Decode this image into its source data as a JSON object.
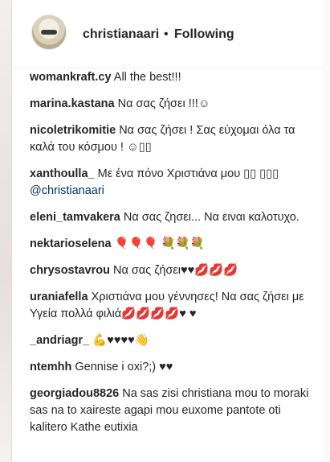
{
  "header": {
    "username": "christianaari",
    "separator": "•",
    "follow_status": "Following"
  },
  "comments": [
    {
      "user": "womankraft.cy",
      "text": "All the best!!!"
    },
    {
      "user": "marina.kastana",
      "text": "Να σας ζήσει !!!☺"
    },
    {
      "user": "nicoletrikomitie",
      "text": "Να σας ζήσει ! Σας εύχομαι όλα τα καλά του κόσμου ! ☺▯▯"
    },
    {
      "user": "xanthoulla_",
      "text": "Με ένα πόνο Χριστιάνα μου ▯▯ ▯▯▯",
      "mention": "@christianaari"
    },
    {
      "user": "eleni_tamvakera",
      "text": "Να σας ζησει... Να ειναι καλοτυχο."
    },
    {
      "user": "nektarioselena",
      "text": "🎈🎈🎈 💐💐💐"
    },
    {
      "user": "chrysostavrou",
      "text": "Να σας ζήσει♥♥💋💋💋"
    },
    {
      "user": "uraniafella",
      "text": "Χριστιάνα μου γέννησες! Να σας ζήσει με Υγεία πολλά φιλιά💋💋💋💋♥ ♥"
    },
    {
      "user": "_andriagr_",
      "text": "💪♥♥♥♥👋"
    },
    {
      "user": "ntemhh",
      "text": "Gennise i oxi?;) ♥♥"
    },
    {
      "user": "georgiadou8826",
      "text": "Na sas zisi christiana mou to moraki sas na to xaireste agapi mou euxome pantote oti kalitero Kathe eutixia"
    }
  ]
}
